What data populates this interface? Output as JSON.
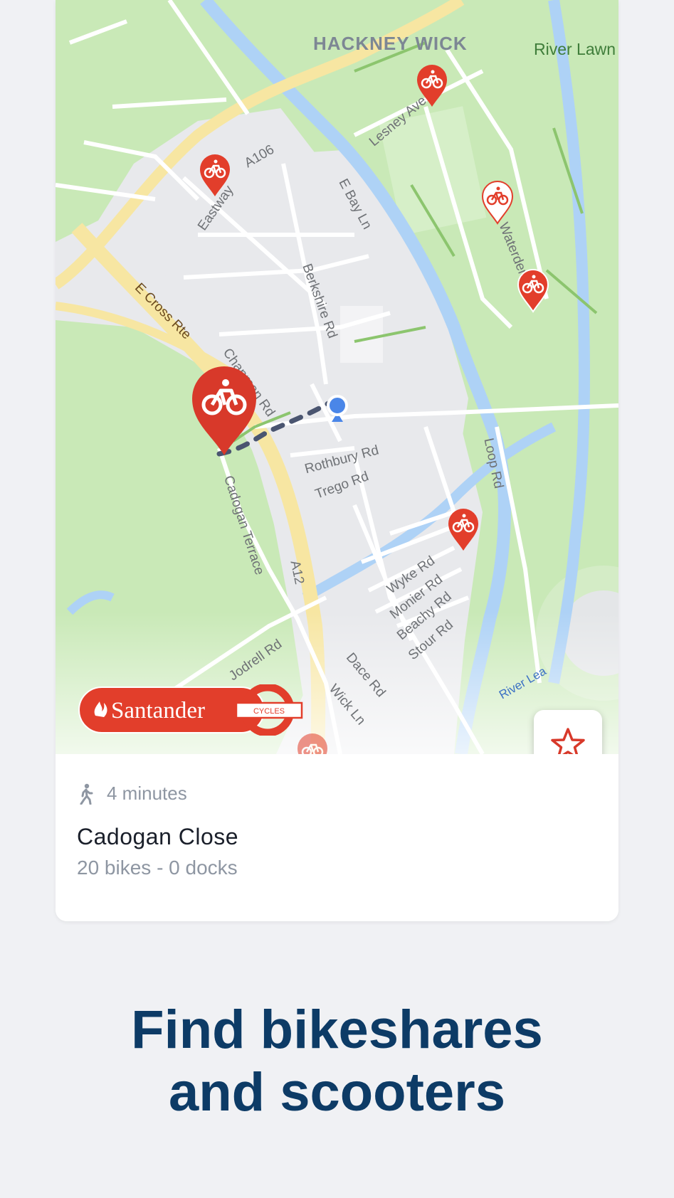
{
  "map": {
    "district_label": "HACKNEY WICK",
    "park_label": "River Lawn",
    "water_label": "River Lea",
    "streets": [
      "A106",
      "Eastway",
      "Lesney Ave",
      "E Bay Ln",
      "Waterden",
      "E Cross Rte",
      "Berkshire Rd",
      "Chapman Rd",
      "Rothbury Rd",
      "Trego Rd",
      "Loop Rd",
      "Cadogan Terrace",
      "A12",
      "Wyke Rd",
      "Monier Rd",
      "Beachy Rd",
      "Stour Rd",
      "Jodrell Rd",
      "Dace Rd",
      "Wick Ln"
    ],
    "brand_logo_text": "Santander",
    "brand_logo_subtext": "CYCLES",
    "colors": {
      "park": "#c7e8b5",
      "water": "#aed2f6",
      "major_road": "#f9eaa3",
      "pin": "#e23e2b",
      "user_location": "#4a86e8"
    }
  },
  "favorite_button": {
    "icon": "star-outline-icon"
  },
  "station": {
    "walk_icon": "walking-person-icon",
    "walk_time": "4 minutes",
    "name": "Cadogan Close",
    "detail": "20 bikes - 0 docks"
  },
  "headline": {
    "line1": "Find bikeshares",
    "line2": "and scooters"
  }
}
